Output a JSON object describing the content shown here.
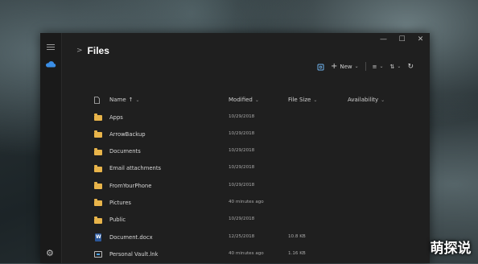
{
  "window": {
    "title": "Files",
    "controls": {
      "minimize": "—",
      "maximize": "☐",
      "close": "✕"
    }
  },
  "toolbar": {
    "new_label": "New"
  },
  "columns": {
    "name": "Name",
    "name_sort": "↑",
    "modified": "Modified",
    "size": "File Size",
    "availability": "Availability"
  },
  "files": [
    {
      "name": "Apps",
      "modified": "10/29/2018",
      "size": "",
      "type": "folder"
    },
    {
      "name": "ArrowBackup",
      "modified": "10/29/2018",
      "size": "",
      "type": "folder"
    },
    {
      "name": "Documents",
      "modified": "10/29/2018",
      "size": "",
      "type": "folder"
    },
    {
      "name": "Email attachments",
      "modified": "10/29/2018",
      "size": "",
      "type": "folder"
    },
    {
      "name": "FromYourPhone",
      "modified": "10/29/2018",
      "size": "",
      "type": "folder"
    },
    {
      "name": "Pictures",
      "modified": "40 minutes ago",
      "size": "",
      "type": "folder"
    },
    {
      "name": "Public",
      "modified": "10/29/2018",
      "size": "",
      "type": "folder"
    },
    {
      "name": "Document.docx",
      "modified": "12/25/2018",
      "size": "10.8 KB",
      "type": "docx"
    },
    {
      "name": "Personal Vault.lnk",
      "modified": "40 minutes ago",
      "size": "1.16 KB",
      "type": "lnk"
    }
  ],
  "watermark": "萌探说"
}
